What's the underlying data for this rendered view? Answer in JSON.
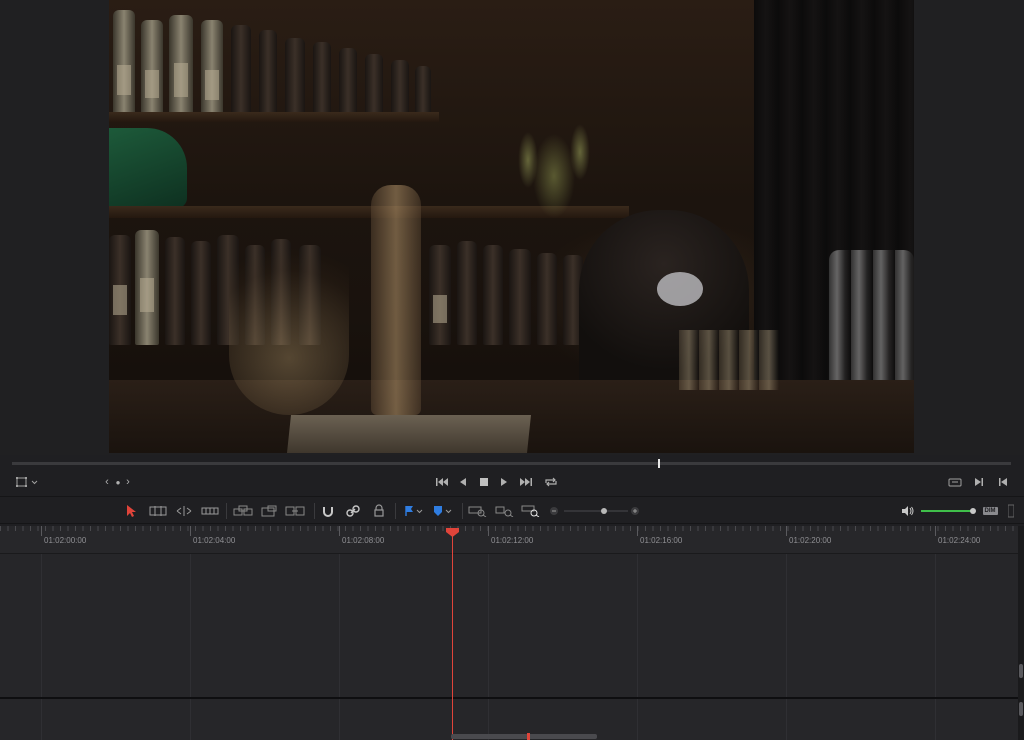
{
  "viewer": {
    "frame_description_icons": [
      "bar-scene-frame"
    ]
  },
  "transport": {
    "nav_prev": "‹",
    "nav_dot": "●",
    "nav_next": "›"
  },
  "toolbar": {
    "audio_level_percent": 100,
    "dim_label": "DIM"
  },
  "ruler": {
    "timecodes": [
      "01:02:00:00",
      "01:02:04:00",
      "01:02:08:00",
      "01:02:12:00",
      "01:02:16:00",
      "01:02:20:00",
      "01:02:24:00"
    ]
  },
  "colors": {
    "playhead": "#e0443a",
    "audio_meter": "#3fbf4a",
    "marker_blue": "#2f7de1",
    "selection_red": "#e0443a"
  }
}
